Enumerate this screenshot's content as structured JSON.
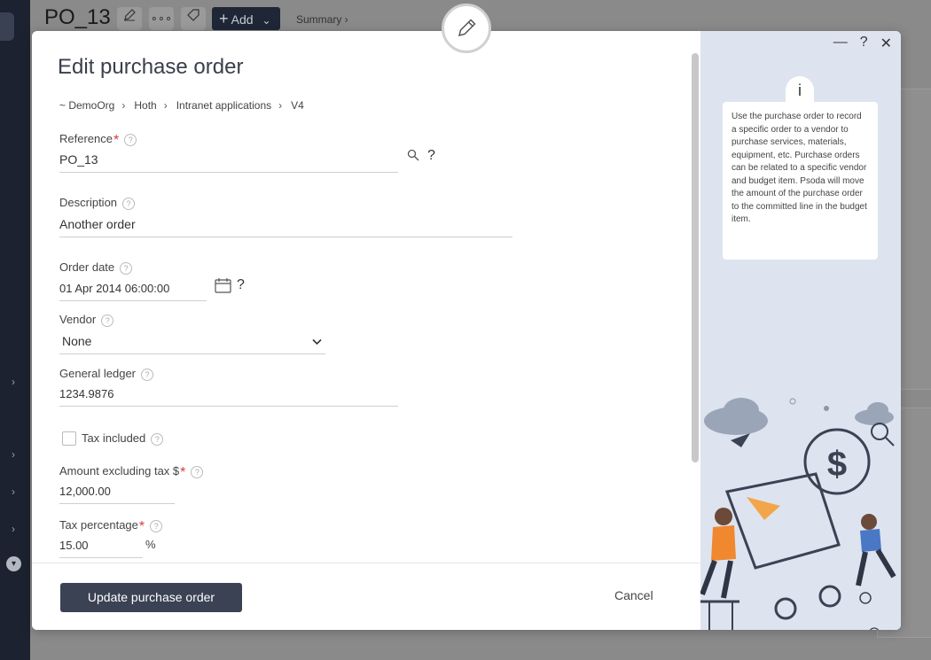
{
  "background": {
    "title": "PO_13",
    "add_label": "Add",
    "summary_label": "Summary ›"
  },
  "modal": {
    "title": "Edit purchase order",
    "breadcrumb": [
      "~ DemoOrg",
      "Hoth",
      "Intranet applications",
      "V4"
    ],
    "window_controls": [
      "—",
      "?",
      "✕"
    ]
  },
  "form": {
    "reference": {
      "label": "Reference",
      "value": "PO_13",
      "required": true
    },
    "description": {
      "label": "Description",
      "value": "Another order"
    },
    "order_date": {
      "label": "Order date",
      "value": "01 Apr 2014 06:00:00"
    },
    "vendor": {
      "label": "Vendor",
      "value": "None"
    },
    "general_ledger": {
      "label": "General ledger",
      "value": "1234.9876"
    },
    "tax_included": {
      "label": "Tax included",
      "checked": false
    },
    "amount_excl_tax": {
      "label": "Amount excluding tax $",
      "value": "12,000.00",
      "required": true
    },
    "tax_percentage": {
      "label": "Tax percentage",
      "value": "15.00",
      "unit": "%",
      "required": true
    }
  },
  "footer": {
    "primary_label": "Update purchase order",
    "cancel_label": "Cancel"
  },
  "info": {
    "icon_label": "i",
    "text": "Use the purchase order to record a specific order to a vendor to purchase services, materials, equipment, etc. Purchase orders can be related to a specific vendor and budget item. Psoda will move the amount of the purchase order to the committed line in the budget item."
  },
  "colors": {
    "primary": "#3b4254",
    "panel": "#dde4ef",
    "required": "#d83a3a"
  }
}
